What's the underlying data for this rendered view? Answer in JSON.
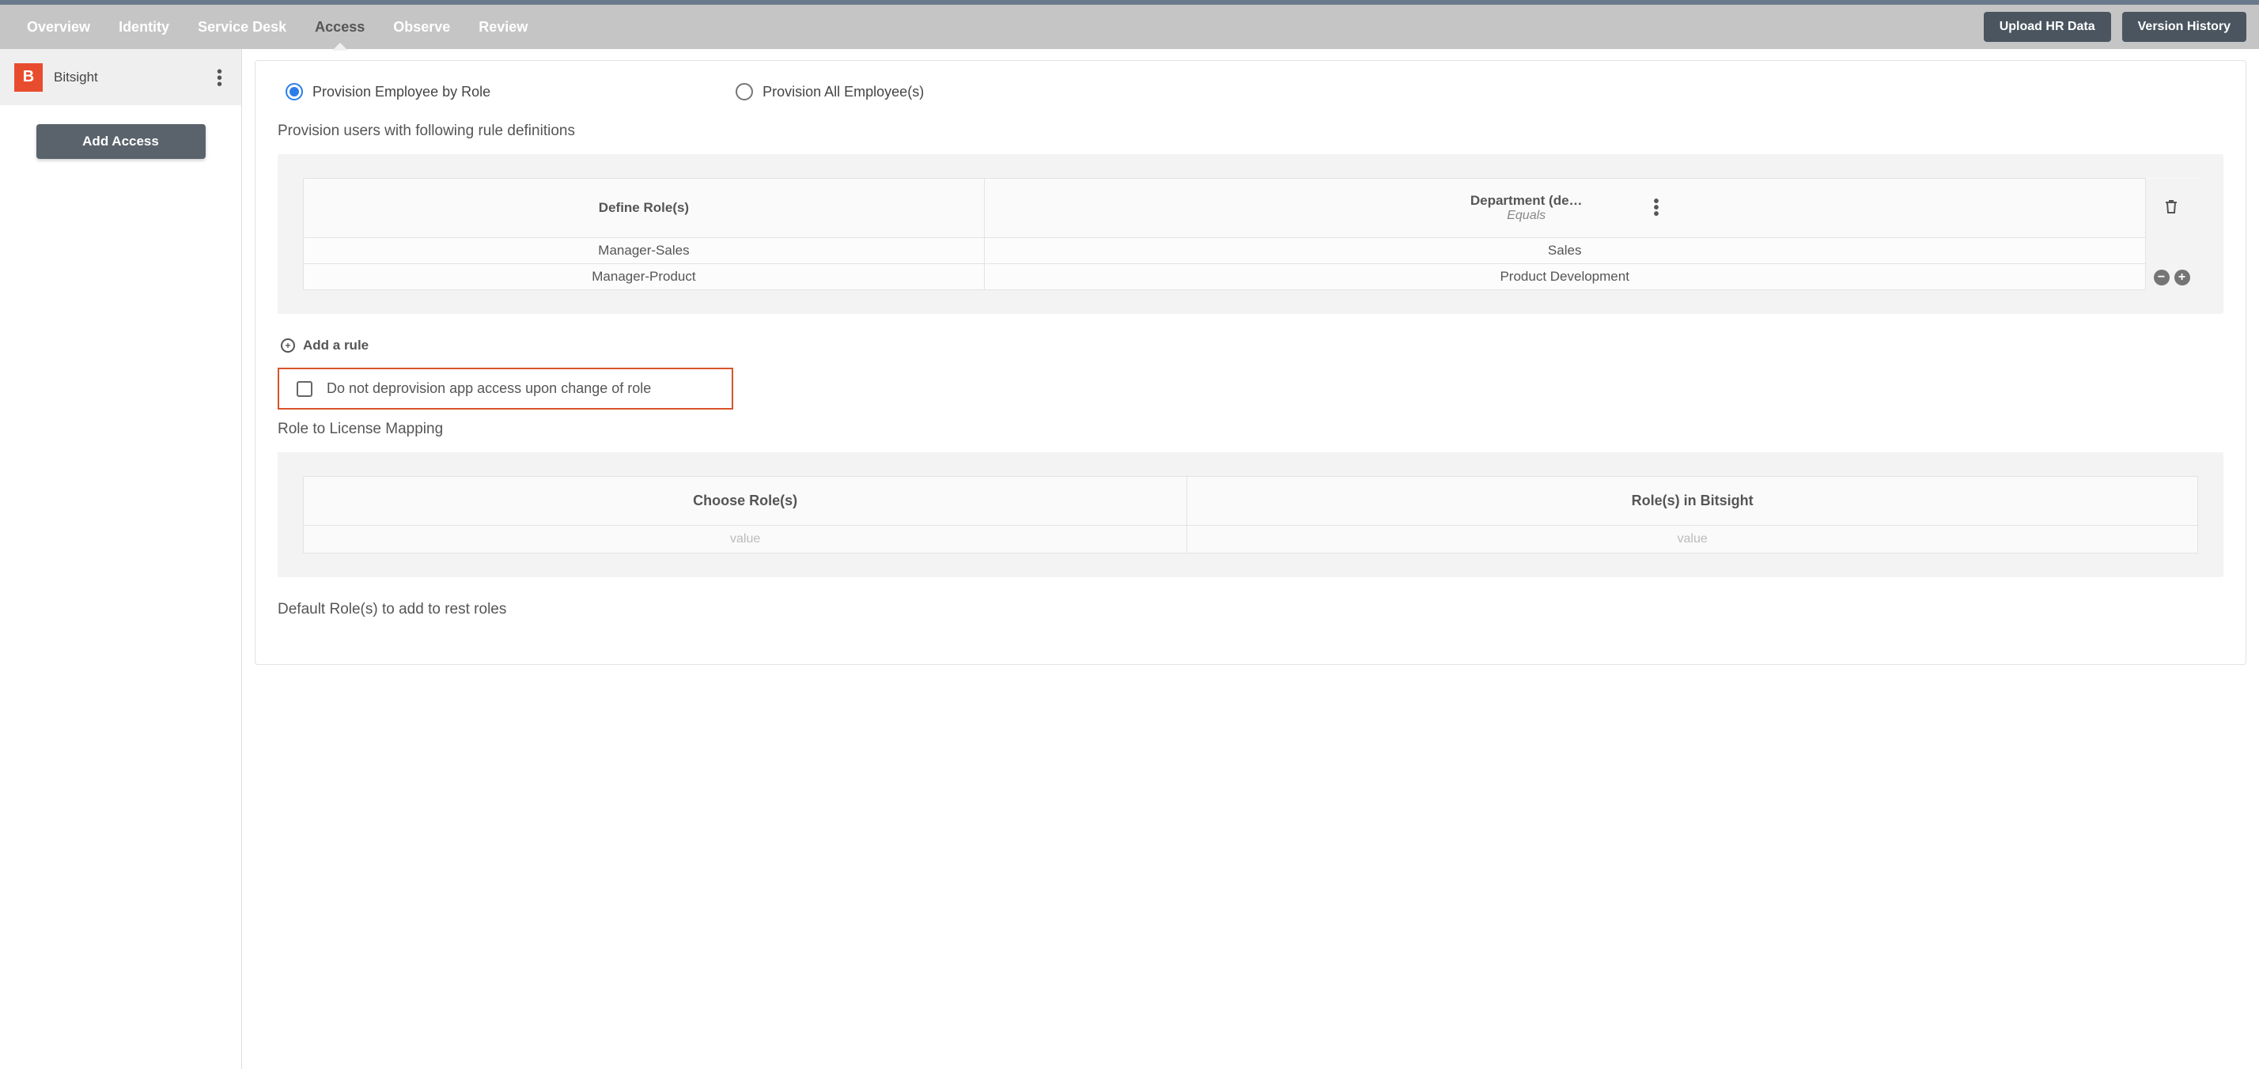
{
  "nav": {
    "tabs": [
      {
        "label": "Overview",
        "active": false
      },
      {
        "label": "Identity",
        "active": false
      },
      {
        "label": "Service Desk",
        "active": false
      },
      {
        "label": "Access",
        "active": true
      },
      {
        "label": "Observe",
        "active": false
      },
      {
        "label": "Review",
        "active": false
      }
    ],
    "upload_btn": "Upload HR Data",
    "version_btn": "Version History"
  },
  "sidebar": {
    "app_name": "Bitsight",
    "app_logo_letter": "B",
    "add_access_btn": "Add Access"
  },
  "main": {
    "radio1": "Provision Employee by Role",
    "radio2": "Provision All Employee(s)",
    "section1_title": "Provision users with following rule definitions",
    "rule_table": {
      "col1_header": "Define Role(s)",
      "col2_header": "Department (de…",
      "col2_sub": "Equals",
      "rows": [
        {
          "role": "Manager-Sales",
          "dept": "Sales"
        },
        {
          "role": "Manager-Product",
          "dept": "Product Development"
        }
      ]
    },
    "add_rule_label": "Add a rule",
    "deprovision_checkbox": "Do not deprovision app access upon change of role",
    "section2_title": "Role to License Mapping",
    "map_table": {
      "col1_header": "Choose Role(s)",
      "col2_header": "Role(s) in Bitsight",
      "placeholder": "value"
    },
    "section3_title": "Default Role(s) to add to rest roles"
  }
}
